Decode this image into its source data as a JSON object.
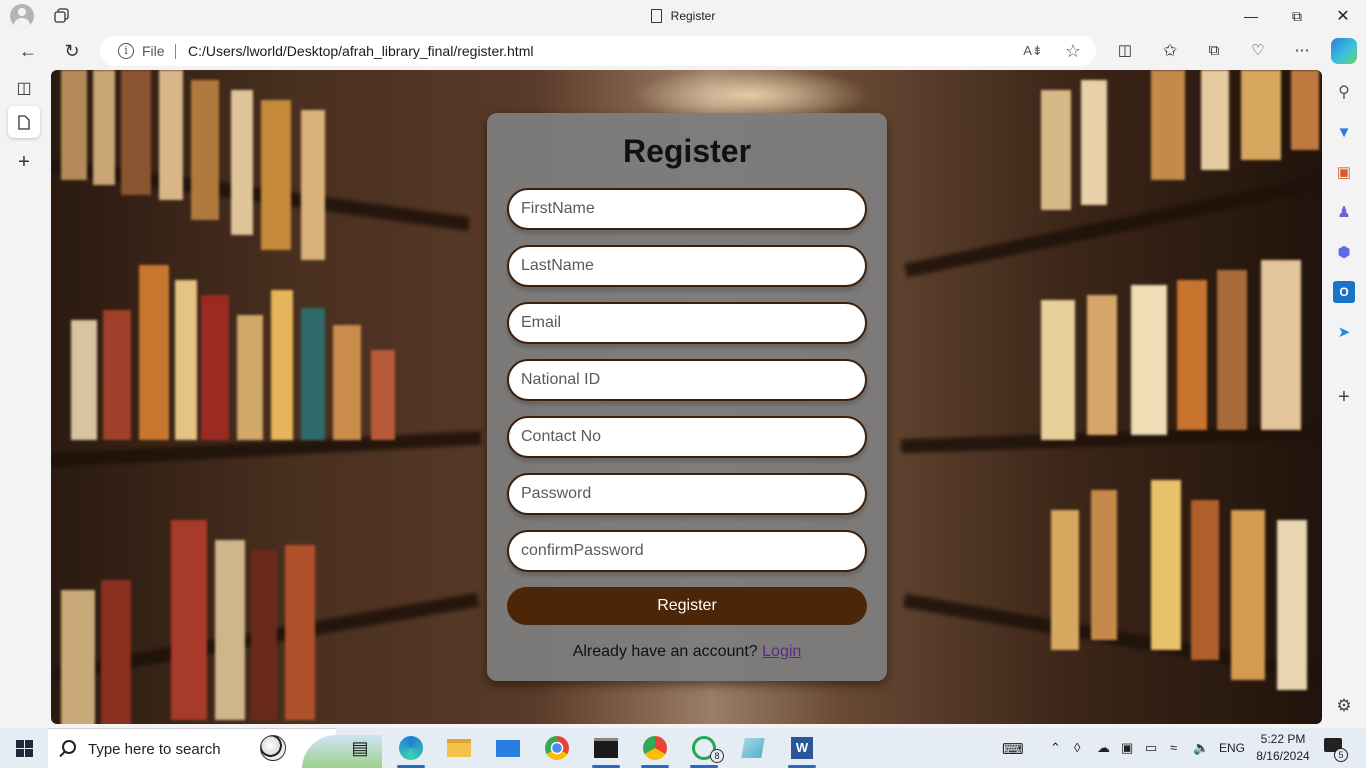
{
  "window": {
    "title": "Register"
  },
  "browser": {
    "address_scheme": "File",
    "url": "C:/Users/lworld/Desktop/afrah_library_final/register.html"
  },
  "form": {
    "heading": "Register",
    "fields": [
      {
        "placeholder": "FirstName"
      },
      {
        "placeholder": "LastName"
      },
      {
        "placeholder": "Email"
      },
      {
        "placeholder": "National ID"
      },
      {
        "placeholder": "Contact No"
      },
      {
        "placeholder": "Password"
      },
      {
        "placeholder": "confirmPassword"
      }
    ],
    "submit_label": "Register",
    "login_prompt": "Already have an account?",
    "login_link": "Login"
  },
  "taskbar": {
    "search_placeholder": "Type here to search",
    "language": "ENG",
    "time": "5:22 PM",
    "date": "8/16/2024",
    "whatsapp_badge": "8",
    "notification_count": "5"
  },
  "colors": {
    "card_bg": "#7d7d7d",
    "field_border": "#3d200c",
    "button_bg": "#4b2608",
    "link": "#5a2a8a"
  }
}
